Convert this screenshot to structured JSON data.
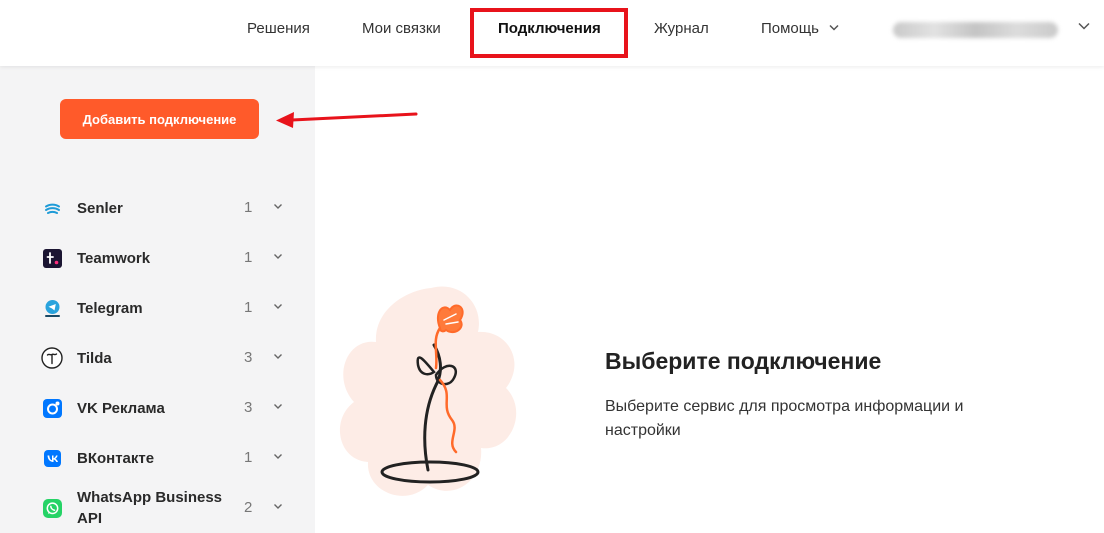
{
  "header": {
    "nav": [
      {
        "label": "Решения"
      },
      {
        "label": "Мои связки"
      },
      {
        "label": "Подключения",
        "active": true
      },
      {
        "label": "Журнал"
      },
      {
        "label": "Помощь",
        "has_dropdown": true
      }
    ],
    "user_menu": {
      "has_dropdown": true
    }
  },
  "sidebar": {
    "add_button_label": "Добавить подключение",
    "connections": [
      {
        "label": "Senler",
        "count": "1",
        "icon": "senler-icon"
      },
      {
        "label": "Teamwork",
        "count": "1",
        "icon": "teamwork-icon"
      },
      {
        "label": "Telegram",
        "count": "1",
        "icon": "telegram-icon"
      },
      {
        "label": "Tilda",
        "count": "3",
        "icon": "tilda-icon"
      },
      {
        "label": "VK Реклама",
        "count": "3",
        "icon": "vk-ads-icon"
      },
      {
        "label": "ВКонтакте",
        "count": "1",
        "icon": "vk-icon"
      },
      {
        "label": "WhatsApp Business API",
        "count": "2",
        "icon": "whatsapp-icon"
      }
    ]
  },
  "main": {
    "empty_state": {
      "title": "Выберите подключение",
      "description": "Выберите сервис для просмотра информации и настройки",
      "illustration": "flower-illustration"
    }
  },
  "colors": {
    "accent": "#ff5a2a",
    "annotation_red": "#e8131b",
    "sidebar_bg": "#f4f4f5"
  }
}
